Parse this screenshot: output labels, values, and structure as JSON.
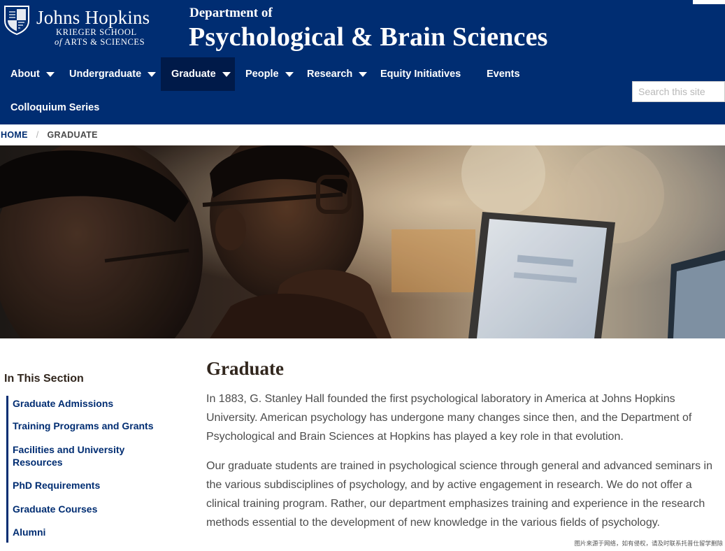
{
  "brand": {
    "university": "Johns Hopkins",
    "school_line1": "KRIEGER SCHOOL",
    "school_line2_of": "of",
    "school_line2": "ARTS & SCIENCES"
  },
  "department": {
    "small": "Department of",
    "name": "Psychological & Brain Sciences"
  },
  "nav": {
    "items": [
      {
        "label": "About",
        "has_caret": true
      },
      {
        "label": "Undergraduate",
        "has_caret": true
      },
      {
        "label": "Graduate",
        "has_caret": true,
        "active": true
      },
      {
        "label": "People",
        "has_caret": true
      },
      {
        "label": "Research",
        "has_caret": true
      },
      {
        "label": "Equity Initiatives",
        "has_caret": false
      },
      {
        "label": "Events",
        "has_caret": false
      },
      {
        "label": "Colloquium Series",
        "has_caret": false
      }
    ]
  },
  "search": {
    "placeholder": "Search this site"
  },
  "breadcrumb": {
    "home": "HOME",
    "separator": "/",
    "current": "GRADUATE"
  },
  "sidebar": {
    "title": "In This Section",
    "links": [
      "Graduate Admissions",
      "Training Programs and Grants",
      "Facilities and University Resources",
      "PhD Requirements",
      "Graduate Courses",
      "Alumni"
    ]
  },
  "main": {
    "title": "Graduate",
    "paragraphs": [
      "In 1883, G. Stanley Hall founded the first psychological laboratory in America at Johns Hopkins University. American psychology has undergone many changes since then, and the Department of Psychological and Brain Sciences at Hopkins has played a key role in that evolution.",
      "Our graduate students are trained in psychological science through general and advanced seminars in the various subdisciplines of psychology, and by active engagement in research. We do not offer a clinical training program. Rather, our department emphasizes training and experience in the research methods essential to the development of new knowledge in the various fields of psychology."
    ]
  },
  "watermark": "图片来源于网络，如有侵权，请及时联系托普仕留学删除",
  "colors": {
    "header_bg": "#002d72",
    "nav_active_bg": "#001a49",
    "link": "#002d72",
    "heading": "#31261d"
  }
}
